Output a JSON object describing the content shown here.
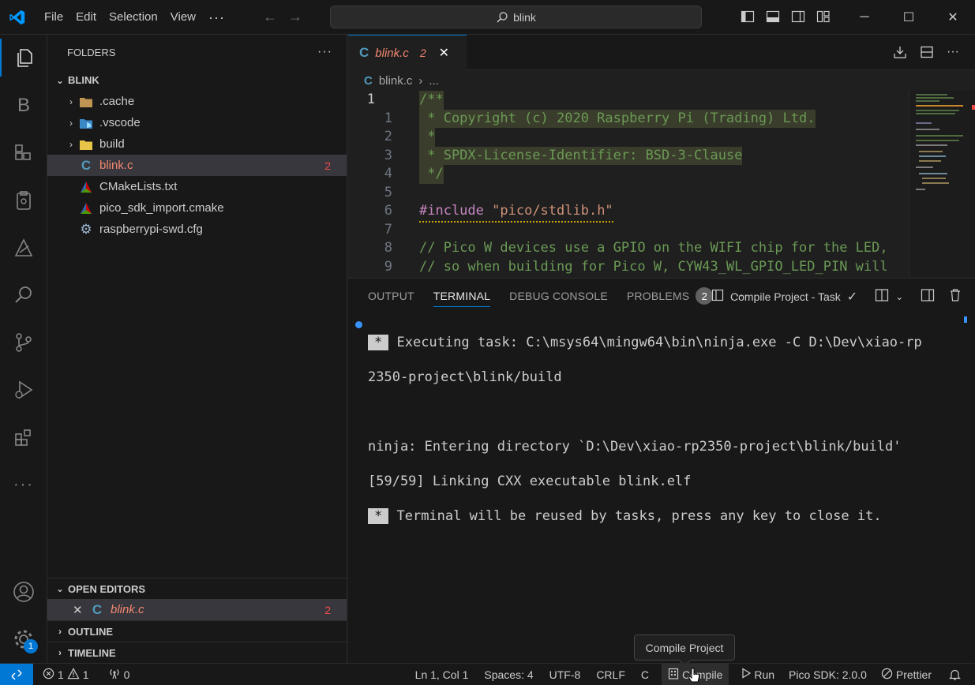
{
  "titlebar": {
    "menu": [
      "File",
      "Edit",
      "Selection",
      "View"
    ],
    "more": "···",
    "search_text": "blink"
  },
  "activity_bar": {
    "icons": [
      "explorer-icon",
      "b-extension-icon",
      "extensions-view-icon",
      "clipboard-icon",
      "pico-icon",
      "search-icon",
      "source-control-icon",
      "run-debug-icon",
      "extensions-icon",
      "more-icon",
      "accounts-icon",
      "settings-icon"
    ],
    "b_letter": "B",
    "settings_badge": "1"
  },
  "sidebar": {
    "header": "FOLDERS",
    "header_more": "···",
    "project": "BLINK",
    "items": [
      {
        "label": ".cache",
        "type": "folder"
      },
      {
        "label": ".vscode",
        "type": "folder"
      },
      {
        "label": "build",
        "type": "folder"
      },
      {
        "label": "blink.c",
        "type": "c",
        "errors": "2"
      },
      {
        "label": "CMakeLists.txt",
        "type": "cmake"
      },
      {
        "label": "pico_sdk_import.cmake",
        "type": "cmake"
      },
      {
        "label": "raspberrypi-swd.cfg",
        "type": "gear"
      }
    ],
    "open_editors": "OPEN EDITORS",
    "open_editor_item": {
      "label": "blink.c",
      "errors": "2"
    },
    "outline": "OUTLINE",
    "timeline": "TIMELINE"
  },
  "editor": {
    "tab": {
      "name": "blink.c",
      "problems": "2"
    },
    "breadcrumb": {
      "file": "blink.c",
      "rest": "..."
    },
    "lines": [
      {
        "num": "1",
        "text": "/**"
      },
      {
        "num": "1",
        "text": " * Copyright (c) 2020 Raspberry Pi (Trading) Ltd."
      },
      {
        "num": "2",
        "text": " *"
      },
      {
        "num": "3",
        "text": " * SPDX-License-Identifier: BSD-3-Clause"
      },
      {
        "num": "4",
        "text": " */"
      },
      {
        "num": "5",
        "text": ""
      },
      {
        "num": "6",
        "text_pre": "#include",
        "text_str": "\"pico/stdlib.h\""
      },
      {
        "num": "7",
        "text": ""
      },
      {
        "num": "8",
        "text": "// Pico W devices use a GPIO on the WIFI chip for the LED,"
      },
      {
        "num": "9",
        "text": "// so when building for Pico W, CYW43_WL_GPIO_LED_PIN will"
      }
    ]
  },
  "panel": {
    "tabs": [
      "OUTPUT",
      "TERMINAL",
      "DEBUG CONSOLE",
      "PROBLEMS"
    ],
    "problems_count": "2",
    "more": "···",
    "task_label": "Compile Project - Task",
    "terminal": [
      {
        "star": "*",
        "text": " Executing task: C:\\msys64\\mingw64\\bin\\ninja.exe -C D:\\Dev\\xiao-rp"
      },
      {
        "text": "2350-project\\blink/build"
      },
      {
        "text": ""
      },
      {
        "text": "ninja: Entering directory `D:\\Dev\\xiao-rp2350-project\\blink/build'"
      },
      {
        "text": "[59/59] Linking CXX executable blink.elf"
      },
      {
        "star": "*",
        "text": " Terminal will be reused by tasks, press any key to close it."
      }
    ]
  },
  "statusbar": {
    "errors": "1",
    "warnings": "1",
    "ports": "0",
    "position": "Ln 1, Col 1",
    "spaces": "Spaces: 4",
    "encoding": "UTF-8",
    "eol": "CRLF",
    "language": "C",
    "compile": "Compile",
    "run": "Run",
    "sdk": "Pico SDK: 2.0.0",
    "prettier": "Prettier"
  },
  "tooltip": "Compile Project",
  "colors": {
    "accent": "#0078d4",
    "error": "#f14c4c",
    "comment": "#6a9955",
    "string": "#ce9178",
    "preproc": "#c586c0"
  }
}
